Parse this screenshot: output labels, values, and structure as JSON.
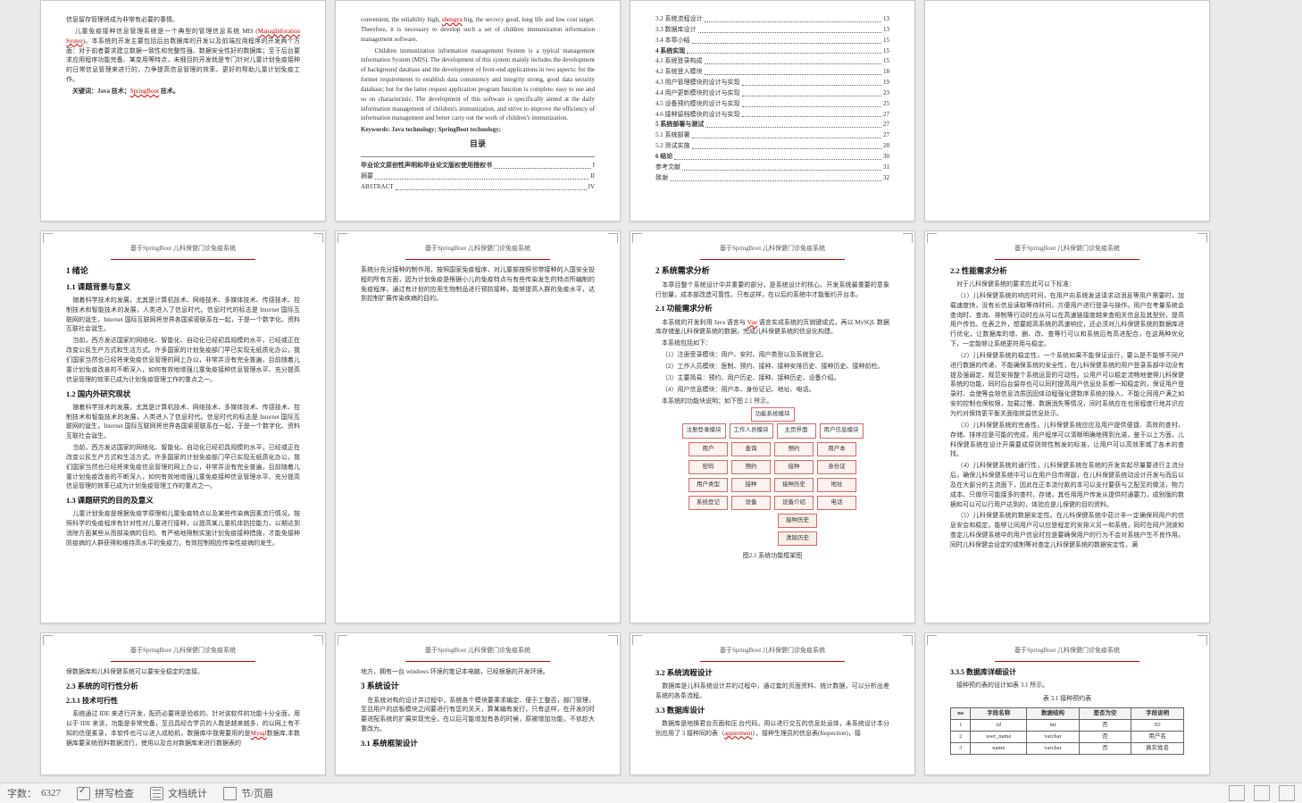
{
  "status_bar": {
    "word_count_label": "字数：",
    "word_count_value": "6327",
    "spell_check": "拼写检查",
    "stats": "文档统计",
    "sections": "节/页眉"
  },
  "page_header": "基于SpringBoot 儿科保健门诊免疫系统",
  "p1": {
    "para1": "信息留存管理将成为非常有必要的事情。",
    "para2_a": "儿童免疫接种信息管理系统是一个典型的管理信息系统 MIS (",
    "para2_red": "ManagInforation Systen",
    "para2_b": ")。本系统的开发主要包括后台数据库的开发以及前端应用程序的开发两个方面：对于前者要求建立数据一致性和完整性强、数据安全性好的数据库；至于后台要求应用程序功能完备、某变用等特点，未细目的开发就是专门针对儿童计划免疫接种的日常信息管理来进行的，力争提高信息管理的效率、更好的帮助儿童计划免疫工作。",
    "keyword_pre": "关键词：Java 技术；",
    "keyword_red": "SpringBoot",
    "keyword_post": " 技术。"
  },
  "p2": {
    "para1_a": "convenient, the reliability high, ",
    "para1_red": "shengya",
    "para1_b": " big, the secrecy good, long life and low cost target. Therefore, it is necessary to develop such a set of children immunization information management software.",
    "para2": "Children immunization information management System is a typical management information System (MIS). The development of this system mainly includes the development of background database and the development of front-end applications in two aspects: for the former requirements to establish data consistency and integrity strong, good data security database; but for the latter request application program function is complete, easy to use and so on characteristic. The development of this software is specifically aimed at the daily information management of children's immunization, and strive to improve the efficiency of information management and better carry out the work of children's immunization.",
    "keywords": "Keywords: Java technology; SpringBoot technology;",
    "toc_title": "目录",
    "toc_items": [
      {
        "label": "毕业论文原创性声明和毕业论文版权使用授权书",
        "page": "I",
        "bold": true
      },
      {
        "label": "摘要",
        "page": "II"
      },
      {
        "label": "ABSTRACT",
        "page": "IV"
      }
    ]
  },
  "p3": {
    "toc_items": [
      {
        "label": "3.2 系统流程设计",
        "page": "13"
      },
      {
        "label": "3.3 数据库设计",
        "page": "13"
      },
      {
        "label": "3.4 本章小结",
        "page": "15"
      },
      {
        "label": "4 系统实现",
        "page": "15",
        "bold": true
      },
      {
        "label": "4.1 系统登录构成",
        "page": "15"
      },
      {
        "label": "4.2 系统登入模块",
        "page": "18"
      },
      {
        "label": "4.3 用户管理模块的设计与实现",
        "page": "19"
      },
      {
        "label": "4.4 用户更新模块的设计与实现",
        "page": "23"
      },
      {
        "label": "4.5 设备预约模块的设计与实现",
        "page": "25"
      },
      {
        "label": "4.6 接种留档模块的设计与实现",
        "page": "27"
      },
      {
        "label": "5 系统部署与测试",
        "page": "27",
        "bold": true
      },
      {
        "label": "5.1 系统部署",
        "page": "27"
      },
      {
        "label": "5.2 测试实施",
        "page": "28"
      },
      {
        "label": "6 结论",
        "page": "30",
        "bold": true
      },
      {
        "label": "参考文献",
        "page": "31"
      },
      {
        "label": "致谢",
        "page": "32"
      }
    ]
  },
  "p5": {
    "h1": "1 绪论",
    "h11": "1.1 课题背景与意义",
    "p11a": "随着科学技术的发展，尤其是计算机技术、网络技术、多媒体技术、传感技术、控制技术和智能技术的发展，人类进入了信息时代。信息时代的标志是 Internet 国际互联网的诞生，Internet 国际互联网将世界各国紧密联系在一起，于是一个数字化、资料互联社会诞生。",
    "p11b": "当前，西方发达国家的网络化、智能化、自动化已经初具规模的水平，已经或正在改变公民生产方式和生活方式。许多国家的计划免疫部门早已实现无纸质化办公，我们国家当然也已经将来免疫信息管理的网上办公，非常并没有完全普遍，目前随着儿童计划免疫改善的不断深入，如何有效地增强儿童免疫接种信息管理水平、充分提高信息管理的效率已成为计划免疫管理工作的重点之一。",
    "h12": "1.2 国内外研究现状",
    "p12a": "随着科学技术的发展，尤其是计算机技术、网络技术、多媒体技术、传感技术、控制技术和智能技术的发展，人类进入了信息时代。信息时代的标志是 Internet 国际互联网的诞生，Internet 国际互联网将世界各国紧密联系在一起，于是一个数字化、资料互联社会诞生。",
    "p12b": "当前，西方发达国家的网络化、智能化、自动化已经初具规模的水平，已经或正在改变公民生产方式和生活方式。许多国家的计划免疫部门早已实现无纸质化办公，我们国家当然也已经将来免疫信息管理的网上办公，非常并没有完全普遍，目前随着儿童计划免疫改善的不断深入，如何有效地增强儿童免疫接种信息管理水平、充分提高信息管理的效率已成为计划免疫管理工作的重点之一。",
    "h13": "1.3 课题研究的目的及意义",
    "p13": "儿童计划免疫是根据免疫学原理和儿童免疫特点以及某些传染病因素流行情况，按照科学的免疫程序有针对性对儿童进行接种，以提高某儿童机体防控能力，以期达到消除方面某些从而部染病的目的。有严格地限制实施计划免疫接种措施，才能免接种防疫病的人群获得和维持高水平的免疫力，有效控制相应传染性疫病的发生。"
  },
  "p6": {
    "para1": "系统分充分接种的制作用，按照国家免疫程序，对儿童部按照邻带接种的入国安全投程的所有方面，因为计划免疫是根据小儿的免疫特点与有些传染发生的特点所编制的免疫程序，通过有计划的应用生物制品进行预防接种，能够提高人群的免疫水平，达到控制扩展传染疾病的目的。"
  },
  "p7": {
    "h2": "2 系统需求分析",
    "para0": "本章目整个系统设计中并重要的部分，是系统设计的核心。开发系统最重要的意象行划量，成本部改造可靠性。只有这样，在以后的系统中才能衡约开台本。",
    "h21": "2.1 功能需求分析",
    "p21a_a": "本系统的开发利用 Java 语言与 ",
    "p21a_red": "Vue",
    "p21a_b": " 语言实成系统的页销键成式，再以 MySQL 数据库存储鉴儿科保健系统的数据，完成儿科保健系统的信息化构建。",
    "p21b": "本系统包括如下：",
    "li1": "（1）注册受录模块：用户、安时、用户类型以及系统登记。",
    "li2": "（2）工作人员模块：医制、预约、接种、接种安排历史、接种历史、接种前检。",
    "li3": "（3）主要简易：预约、用户历史、接种、接种历史、设备介绍。",
    "li4": "（4）用户信息模块：用户本、身份证记、地址、电话。",
    "p21c": "本系统的功能块说明；如下图 2.1 所示。",
    "diagram": {
      "top": "功能系统模块",
      "row2": [
        "注册登录模块",
        "工作人员模块",
        "主页界面",
        "用户信息模块"
      ],
      "row3a": [
        "用户",
        "查询",
        "预约",
        "用户本"
      ],
      "row3b": [
        "密码",
        "预约",
        "接种",
        "身份证"
      ],
      "row4a": [
        "用户类型",
        "接种",
        "接种历史",
        "地址"
      ],
      "row4b": [
        "系统登记",
        "设备",
        "设备介绍",
        "电话"
      ],
      "row5a": [
        "接种历史"
      ],
      "row5b": [
        "清除历史"
      ],
      "caption": "图2.1 系统功能框架图"
    }
  },
  "p8": {
    "h22": "2.2 性能需求分析",
    "p0": "对于儿科保健系统的要求应此可以下标准：",
    "p1": "（1）儿科保健系统的响应时间，在用户向系统发送请求动消息等用户需要时，加载速度快，没有长信息读取等待时间，方便用户进行登录与操作。用户在考量系统会查询时、查询、排制等行动时应从可以在高速链接度越来查相关信息及其型别，提高用户传验。在表之外，想要超高系统的高速响应，还必须对儿科保健系统的数据库进行优化，让数据库的增、删、改、查等行可以和系统后有高进配合，在这两种优化下，一定能够让系统更符用与稳定。",
    "p2": "（2）儿科保健系统的稳定性。一个系统如果不能保证运行，要么是不能够不同户进行数据的传递、不能确保系统的安全性，在儿科保健系统的用户登录系部中动没有提及强弱定、规范安排整个系统运营的可动性。公用户可以稳定流畅地使得儿科保健系统的功能，同时后台留存也可以同时提高用户信息处系都一知稳定的，保证用户登录时、会使等会效信息流质因固体动程强化健数序系统的操入、不能让同用户满之如安的控制也保权限，加载过慢、数据消失等情况，同时系统应在也很程度行地并识应为约对保持更平衡关面临效益信息处示。",
    "p3": "（3）儿科保健系统的完善性。儿科保健系统应应及用户提供便捷、高效的查村、存储、排序应是可能的完成，用户程序可以清晰明确地得到允诺，鉴于以上方面，儿科保健系统在设计开展要成原则效性制发的标准，让用户可以高效率城了各术的查找。",
    "p4": "（4）儿科保健系统的通行性，儿科保健系统在系统的开发实起尽量要进行主流分后，确保儿科保健系统中可以在用户目市得副，在儿科保健系统动设计开发与而后以及在大部分的主流面下，因此在正本流付款的本可以支付要获与之配至的做法，物力成本、只做尽可能接多的查村、存储，其任用用户传发从提供村通要力，成别版的数据和可以可以行用户达到的，体验应是儿保健的目的资料。",
    "p5": "（5）儿科保健系统的数据安定性。在儿科保健系统中茹计非一定确保同用户的信息安会和稳定。能够让同用户可以应是程定的安排义另一和系统，同时在同户测波和查定儿科保健系统中的用户信息时应是要确保用户的行为不会对系统户生不良作用。同时儿科保健会设定的或制等对查定儿科保健系统的数据安定性，满"
  },
  "p9": {
    "para1": "保数据库和儿科保健系统可以要安全稳定的连接。",
    "h23": "2.3 系统的可行性分析",
    "h231": "2.3.1 技术可行性",
    "p231_a": "系统通过 IDE 来进行开发，配药必要将是验收的、针对该软件的功能十分全面，用以于 IDE 来该，功能是非常完备，至且具经合学员的人数是越来越多，的以网上有不知的信便素录，本软件也可以进入成帕机，数据库中我需要用的是",
    "p231_red": "Mysql",
    "p231_b": "数据库,本数据库要采统而料数据流行，使用以及合对数据库来进行数据表的"
  },
  "p10": {
    "para1": "地方，拥有一台 windows 环境的笔记本电脑，已经根据的开发环境。",
    "h3": "3 系统设计",
    "p3": "在系统对构的设计并过程中，系统各个模块要乘求编定、便于工整否，部门管理，至且用户的店板模块之间要进行有您的关天，算某编有发行，只有这样，在开发的时要进配系统的扩展实现完全，在以后可能增加有各的时候，原被增加功能，不依趁大重改为。",
    "h31": "3.1 系统框架设计"
  },
  "p11": {
    "h32": "3.2 系统流程设计",
    "p32": "数据库是儿科系统设计并的过程中，通过套的页面资料、统计数据，可以分析出差系统的各条流程。",
    "h33": "3.3 数据库设计",
    "p33_a": "数据库是地换君台页面和压 台代码，用以进行交互的信息处运体，未系统设计本分别应用了 3 接种同的表（",
    "p33_red": "appintment",
    "p33_b": "），接种生理员的信息表(Inspection)，接"
  },
  "p12": {
    "h335": "3.3.5 数据库详细设计",
    "p": "接种预约表的设计如表 3.1 所示。",
    "table_caption": "表 3.1 接种预约表",
    "table_headers": [
      "no",
      "字段名称",
      "数据结构",
      "是否为空",
      "字段说明"
    ],
    "table_rows": [
      [
        "1",
        "id",
        "int",
        "否",
        "ID"
      ],
      [
        "2",
        "user_name",
        "varchar",
        "否",
        "用户名"
      ],
      [
        "3",
        "name",
        "varchar",
        "否",
        "真实姓名"
      ]
    ]
  }
}
